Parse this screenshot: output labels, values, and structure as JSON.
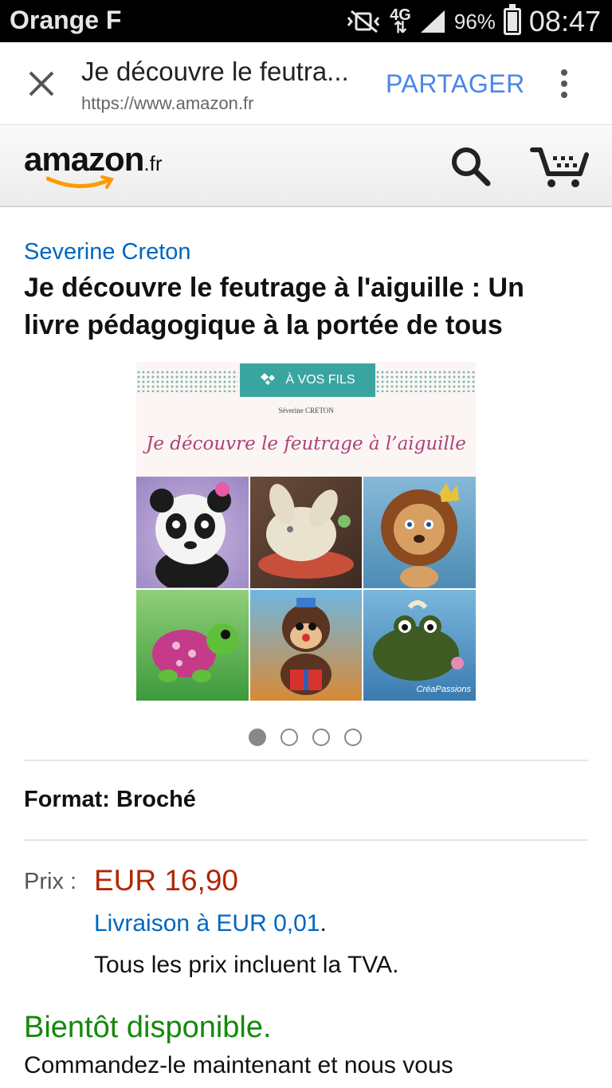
{
  "status_bar": {
    "carrier": "Orange F",
    "network": "4G",
    "battery": "96%",
    "time": "08:47"
  },
  "tab_bar": {
    "title": "Je découvre le feutra...",
    "url": "https://www.amazon.fr",
    "share_label": "PARTAGER"
  },
  "header": {
    "logo": "amazon",
    "logo_tld": ".fr"
  },
  "product": {
    "author": "Severine Creton",
    "title": "Je découvre le feutrage à l'aiguille : Un livre pédagogique à la portée de tous",
    "cover": {
      "series": "À VOS FILS",
      "author": "Séverine CRETON",
      "title": "Je découvre le feutrage à l’aiguille",
      "publisher": "CréaPassions"
    },
    "carousel": {
      "count": 4,
      "active_index": 0
    },
    "format": "Format: Broché",
    "price_label": "Prix :",
    "price": "EUR 16,90",
    "delivery": "Livraison à EUR 0,01",
    "delivery_end": ".",
    "vat_note": "Tous les prix incluent la TVA.",
    "availability": "Bientôt disponible.",
    "order_note": "Commandez-le maintenant et nous vous"
  },
  "colors": {
    "link": "#0066c0",
    "price": "#b12704",
    "availability": "#138a0b",
    "share": "#4a86e8",
    "cover_accent": "#3aa5a0",
    "cover_title": "#b0407a"
  }
}
